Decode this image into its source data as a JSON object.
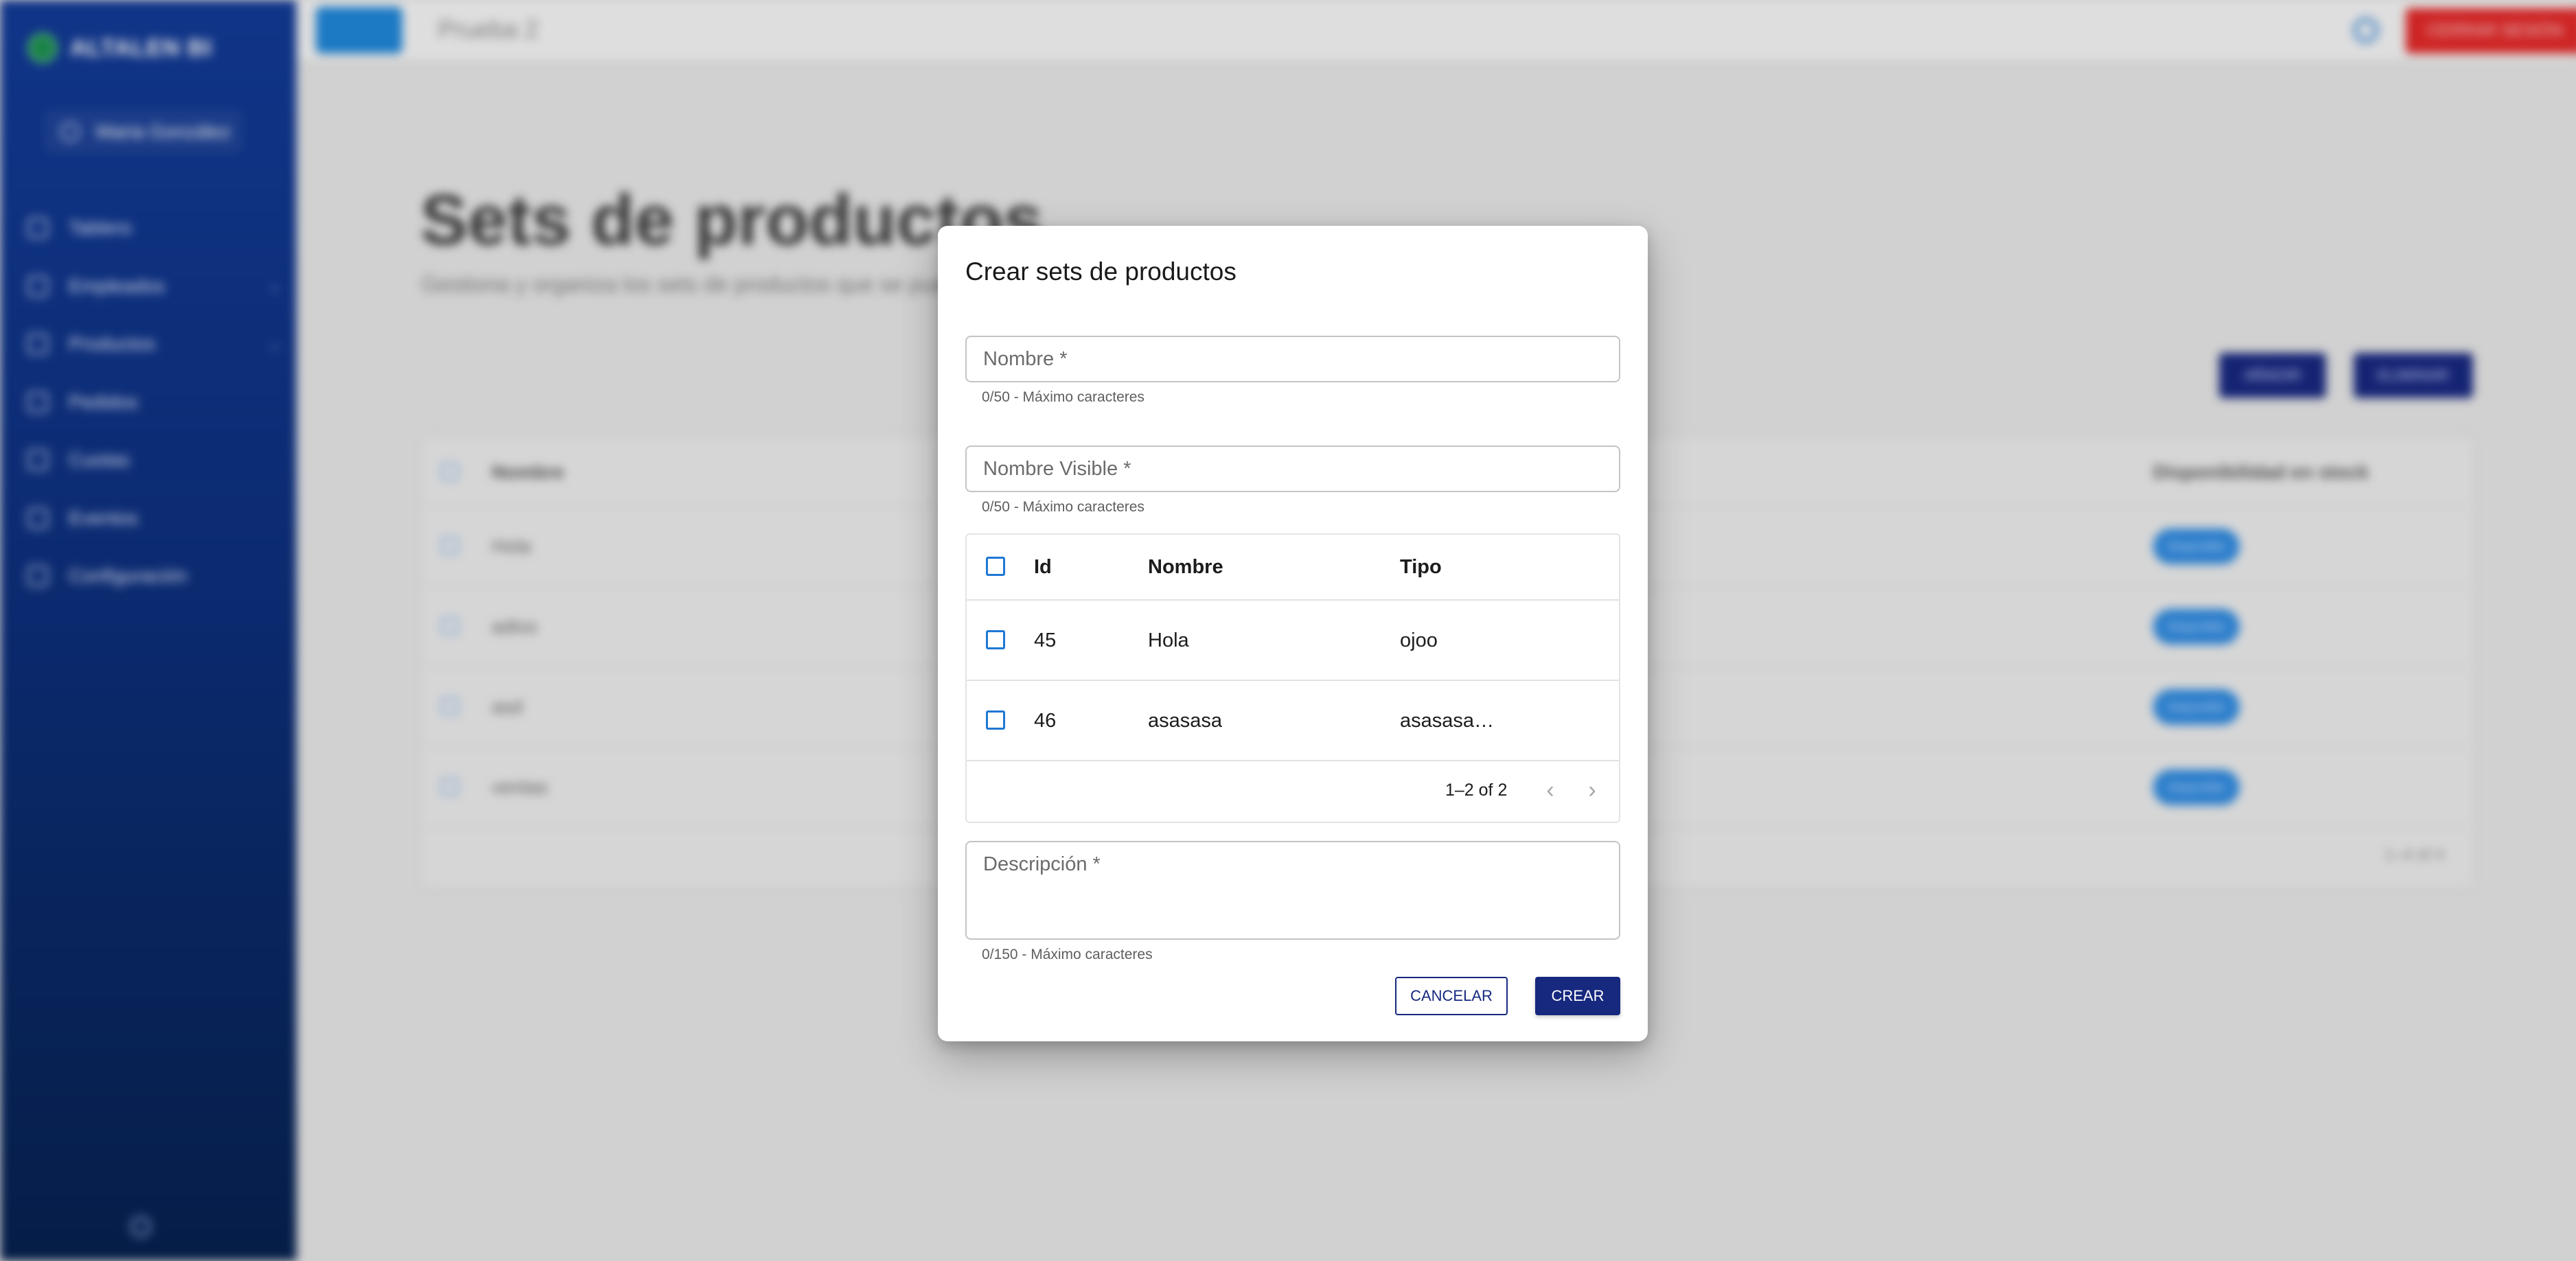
{
  "app": {
    "brand": "ALTALEN BI",
    "user_name": "Maria González",
    "topbar_title": "Prueba 2",
    "logout_label": "CERRAR SESIÓN"
  },
  "sidebar": {
    "items": [
      {
        "label": "Tablero",
        "icon": "home-icon"
      },
      {
        "label": "Empleados",
        "icon": "users-icon",
        "expandable": true
      },
      {
        "label": "Productos",
        "icon": "tag-icon",
        "expandable": true
      },
      {
        "label": "Pedidos",
        "icon": "inbox-icon"
      },
      {
        "label": "Cuotas",
        "icon": "wallet-icon"
      },
      {
        "label": "Eventos",
        "icon": "calendar-icon"
      },
      {
        "label": "Configuración",
        "icon": "gear-icon"
      }
    ]
  },
  "page": {
    "title": "Sets de productos",
    "subtitle": "Gestiona y organiza los sets de productos que se pueden vender",
    "add_label": "AÑADIR",
    "delete_label": "ELIMINAR",
    "table": {
      "columns": [
        "Nombre",
        "Disponibilidad en stock"
      ],
      "rows": [
        {
          "name": "Hola",
          "availability": "Disponible"
        },
        {
          "name": "adios",
          "availability": "Disponible"
        },
        {
          "name": "asd",
          "availability": "Disponible"
        },
        {
          "name": "ventas",
          "availability": "Disponible"
        }
      ],
      "pagination": "1–4 of 4"
    }
  },
  "modal": {
    "title": "Crear sets de productos",
    "nombre": {
      "placeholder": "Nombre *",
      "helper": "0/50 - Máximo caracteres"
    },
    "nombre_visible": {
      "placeholder": "Nombre Visible *",
      "helper": "0/50 - Máximo caracteres"
    },
    "grid": {
      "columns": {
        "id": "Id",
        "nombre": "Nombre",
        "tipo": "Tipo"
      },
      "rows": [
        {
          "id": "45",
          "nombre": "Hola",
          "tipo": "ojoo"
        },
        {
          "id": "46",
          "nombre": "asasasa",
          "tipo": "asasasa…"
        }
      ],
      "pagination": "1–2 of 2"
    },
    "descripcion": {
      "placeholder": "Descripción *",
      "helper": "0/150 - Máximo caracteres"
    },
    "cancel_label": "CANCELAR",
    "create_label": "CREAR"
  }
}
